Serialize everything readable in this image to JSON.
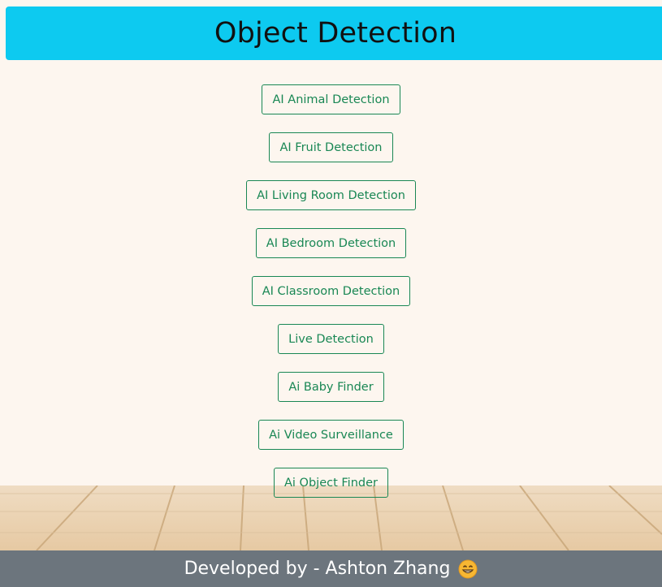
{
  "header": {
    "title": "Object Detection"
  },
  "menu": {
    "buttons": [
      {
        "label": "AI Animal Detection"
      },
      {
        "label": "AI Fruit Detection"
      },
      {
        "label": "AI Living Room Detection"
      },
      {
        "label": "AI Bedroom Detection"
      },
      {
        "label": "AI Classroom Detection"
      },
      {
        "label": "Live Detection"
      },
      {
        "label": "Ai Baby Finder"
      },
      {
        "label": "Ai Video Surveillance"
      },
      {
        "label": "Ai Object Finder"
      }
    ]
  },
  "footer": {
    "text": "Developed by - Ashton Zhang",
    "emoji_icon": "grinning-face-icon"
  },
  "colors": {
    "header_bg": "#0dcaf0",
    "button_accent": "#198754",
    "footer_bg": "#6c757d",
    "page_bg": "#fdf6ef"
  }
}
